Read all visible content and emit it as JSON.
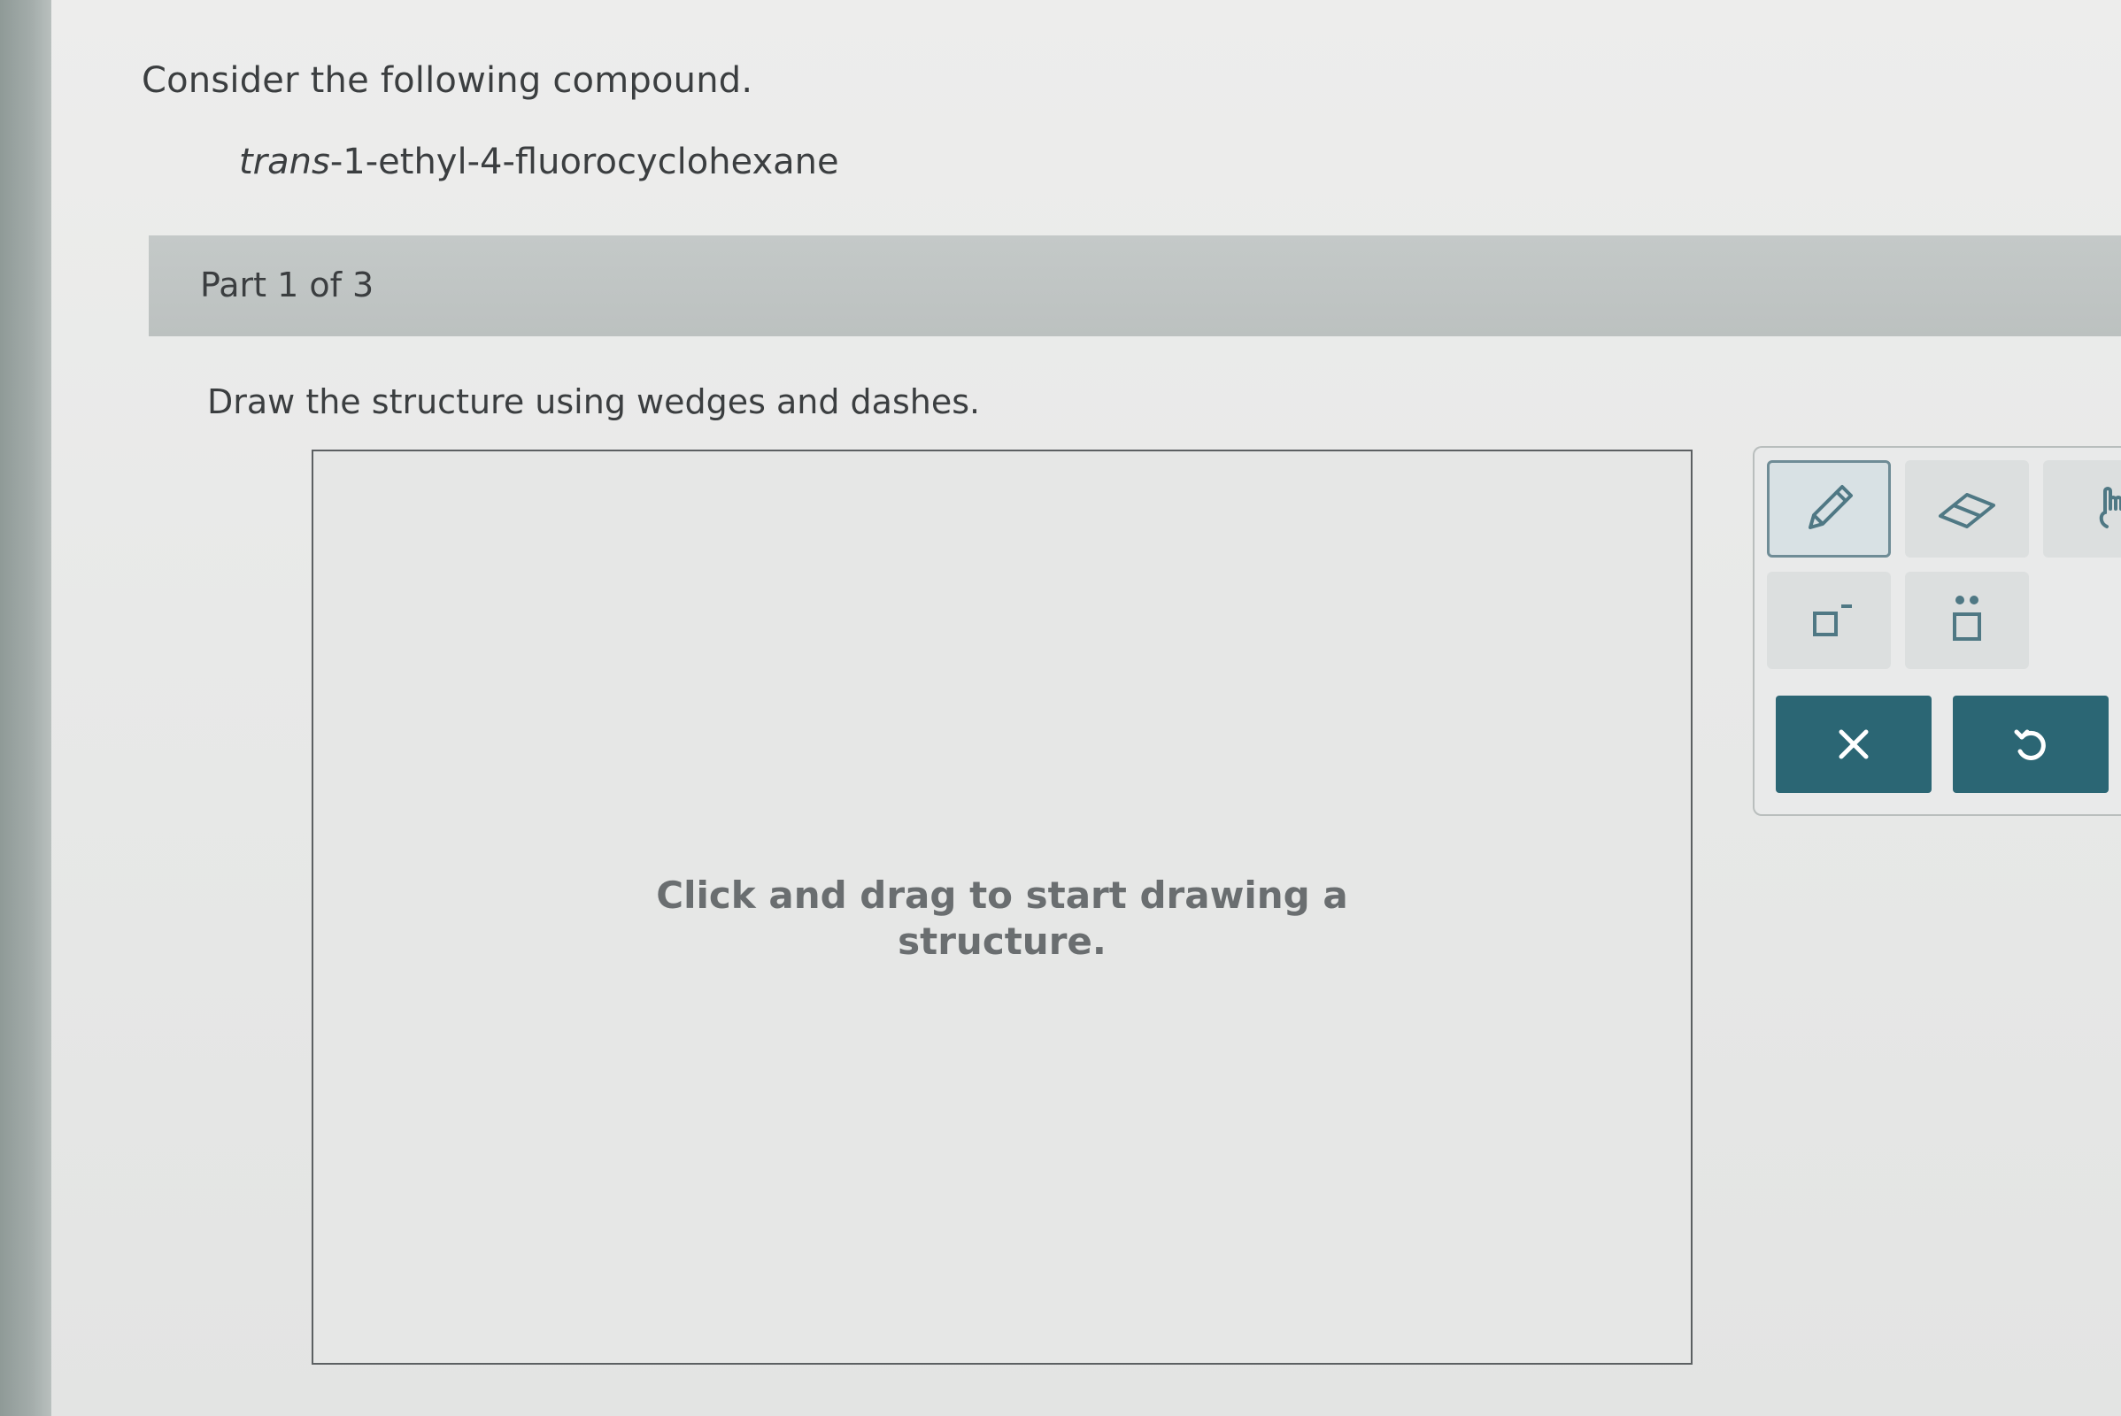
{
  "question": {
    "intro": "Consider the following compound.",
    "compound_prefix": "trans",
    "compound_rest": "-1-ethyl-4-fluorocyclohexane"
  },
  "part": {
    "label": "Part 1 of 3"
  },
  "task": {
    "instruction": "Draw the structure using wedges and dashes."
  },
  "canvas": {
    "hint_line1": "Click and drag to start drawing a",
    "hint_line2": "structure."
  },
  "toolbar": {
    "tools": [
      {
        "name": "pencil",
        "icon": "pencil-icon",
        "selected": true
      },
      {
        "name": "eraser",
        "icon": "eraser-icon",
        "selected": false
      },
      {
        "name": "templates",
        "icon": "templates-icon",
        "selected": false
      },
      {
        "name": "charge",
        "icon": "charge-icon",
        "selected": false
      },
      {
        "name": "lone-pair",
        "icon": "lone-pair-icon",
        "selected": false
      }
    ],
    "actions": [
      {
        "name": "clear",
        "icon": "x-icon"
      },
      {
        "name": "undo",
        "icon": "undo-icon"
      }
    ]
  },
  "colors": {
    "accent": "#2b6674",
    "selected_border": "#6f8c96",
    "part_bar": "#c0c5c4"
  }
}
